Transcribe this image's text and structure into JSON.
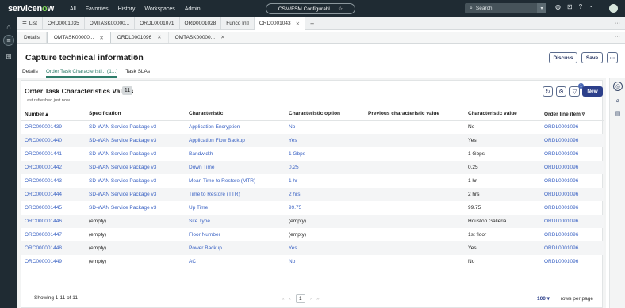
{
  "topnav": {
    "logo": "servicenow",
    "menu": [
      "All",
      "Favorites",
      "History",
      "Workspaces",
      "Admin"
    ],
    "workspace_pill": "CSM/FSM Configurabl...",
    "search_placeholder": "Search"
  },
  "window_tabs": [
    {
      "label": "List"
    },
    {
      "label": "ORD0001035"
    },
    {
      "label": "OMTASK00000..."
    },
    {
      "label": "ORDL0001071"
    },
    {
      "label": "ORD0001028"
    },
    {
      "label": "Funco Intl"
    },
    {
      "label": "ORD0001043"
    }
  ],
  "record_tabs": [
    {
      "label": "Details"
    },
    {
      "label": "OMTASK00000..."
    },
    {
      "label": "ORDL0001096"
    },
    {
      "label": "OMTASK00000..."
    }
  ],
  "header": {
    "title": "Capture technical information",
    "discuss": "Discuss",
    "save": "Save",
    "more": "···",
    "subtabs": [
      "Details",
      "Order Task Characteristi... (1...)",
      "Task SLAs"
    ]
  },
  "list": {
    "title": "Order Task Characteristics Values",
    "count": "11",
    "refreshed": "Last refreshed just now",
    "filter_badge": "1",
    "new_label": "New",
    "columns": [
      "Number",
      "Specification",
      "Characteristic",
      "Characteristic option",
      "Previous characteristic value",
      "Characteristic value",
      "Order line item"
    ],
    "rows": [
      {
        "number": "ORC000001439",
        "spec": "SD-WAN Service Package v3",
        "char": "Application Encryption",
        "option": "No",
        "prev": "",
        "value": "No",
        "line": "ORDL0001096"
      },
      {
        "number": "ORC000001440",
        "spec": "SD-WAN Service Package v3",
        "char": "Application Flow Backup",
        "option": "Yes",
        "prev": "",
        "value": "Yes",
        "line": "ORDL0001096"
      },
      {
        "number": "ORC000001441",
        "spec": "SD-WAN Service Package v3",
        "char": "Bandwidth",
        "option": "1 Gbps",
        "prev": "",
        "value": "1 Gbps",
        "line": "ORDL0001096"
      },
      {
        "number": "ORC000001442",
        "spec": "SD-WAN Service Package v3",
        "char": "Down Time",
        "option": "0.25",
        "prev": "",
        "value": "0.25",
        "line": "ORDL0001096"
      },
      {
        "number": "ORC000001443",
        "spec": "SD-WAN Service Package v3",
        "char": "Mean Time to Restore (MTR)",
        "option": "1 hr",
        "prev": "",
        "value": "1 hr",
        "line": "ORDL0001096"
      },
      {
        "number": "ORC000001444",
        "spec": "SD-WAN Service Package v3",
        "char": "Time to Restore (TTR)",
        "option": "2 hrs",
        "prev": "",
        "value": "2 hrs",
        "line": "ORDL0001096"
      },
      {
        "number": "ORC000001445",
        "spec": "SD-WAN Service Package v3",
        "char": "Up Time",
        "option": "99.75",
        "prev": "",
        "value": "99.75",
        "line": "ORDL0001096"
      },
      {
        "number": "ORC000001446",
        "spec": "(empty)",
        "char": "Site Type",
        "option": "(empty)",
        "prev": "",
        "value": "Houston Galleria",
        "line": "ORDL0001096"
      },
      {
        "number": "ORC000001447",
        "spec": "(empty)",
        "char": "Floor Number",
        "option": "(empty)",
        "prev": "",
        "value": "1st floor",
        "line": "ORDL0001096"
      },
      {
        "number": "ORC000001448",
        "spec": "(empty)",
        "char": "Power Backup",
        "option": "Yes",
        "prev": "",
        "value": "Yes",
        "line": "ORDL0001096"
      },
      {
        "number": "ORC000001449",
        "spec": "(empty)",
        "char": "AC",
        "option": "No",
        "prev": "",
        "value": "No",
        "line": "ORDL0001096"
      }
    ],
    "footer": {
      "showing": "Showing 1-11 of 11",
      "page": "1",
      "rows_per_page_value": "100",
      "rows_per_page_label": "rows per page"
    }
  }
}
